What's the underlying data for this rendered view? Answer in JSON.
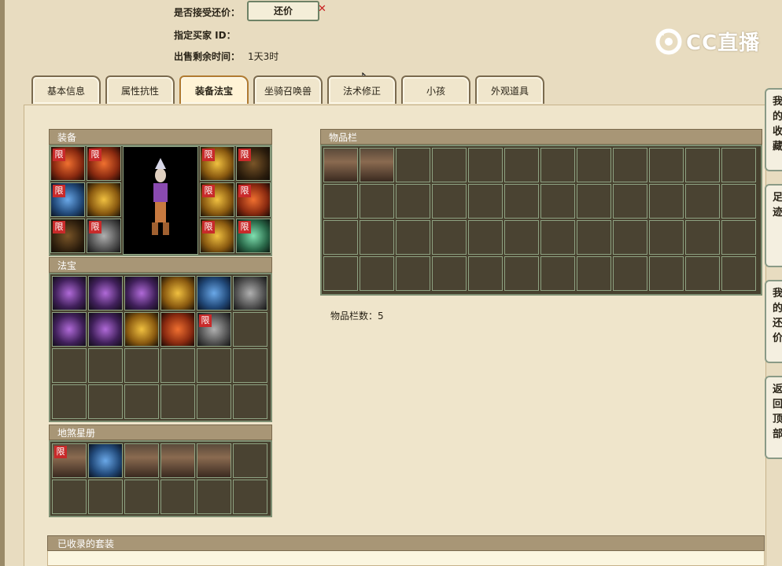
{
  "info": {
    "accept_counter_label": "是否接受还价：",
    "counter_button": "还价",
    "buyer_id_label": "指定买家 ID：",
    "time_left_label": "出售剩余时间：",
    "time_left_value": "1天3时"
  },
  "logo": {
    "text": "CC直播"
  },
  "tabs": [
    {
      "label": "基本信息"
    },
    {
      "label": "属性抗性"
    },
    {
      "label": "装备法宝",
      "active": true
    },
    {
      "label": "坐骑召唤兽"
    },
    {
      "label": "法术修正"
    },
    {
      "label": "小孩"
    },
    {
      "label": "外观道具"
    }
  ],
  "sections": {
    "equipment": "装备",
    "treasure": "法宝",
    "star_book": "地煞星册",
    "inventory": "物品栏",
    "inventory_count_label": "物品栏数：",
    "inventory_count": "5",
    "collected_sets": "已收录的套装"
  },
  "limit_badge": "限",
  "side_buttons": [
    {
      "label": "我的收藏"
    },
    {
      "label": "足迹"
    },
    {
      "label": "我的还价"
    },
    {
      "label": "返回顶部"
    }
  ],
  "colors": {
    "limit_badge": "#c82a2a",
    "active_tab": "#b07a30",
    "grid_line": "#8ea282"
  }
}
